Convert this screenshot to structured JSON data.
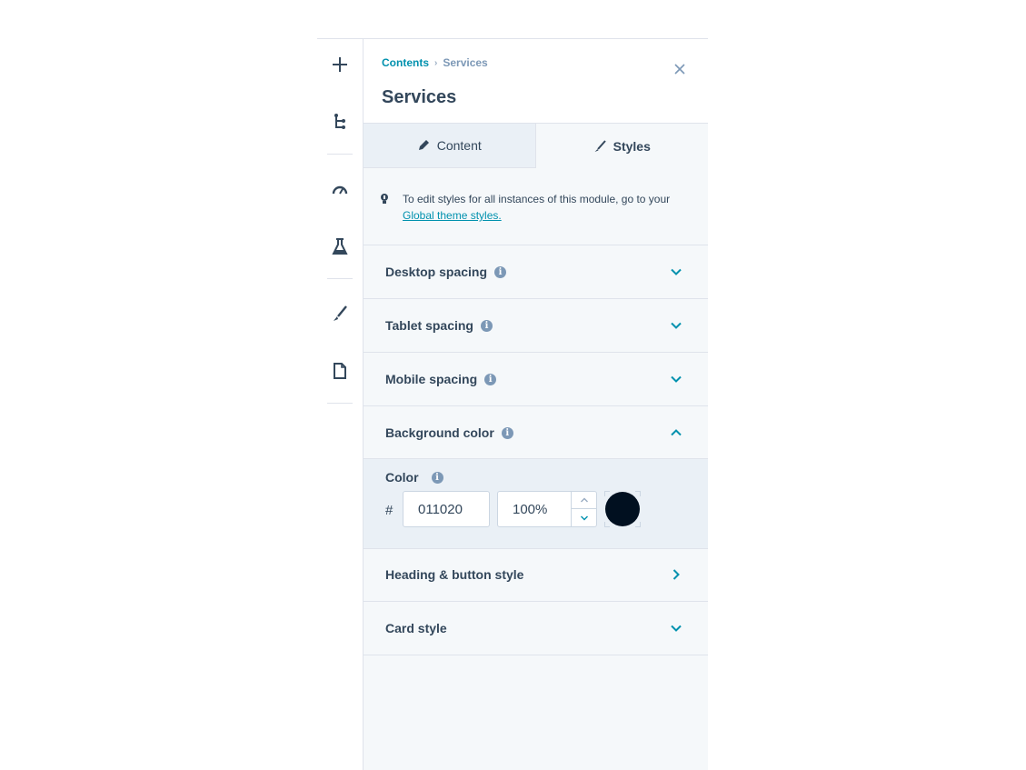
{
  "breadcrumb": {
    "parent": "Contents",
    "separator": "›",
    "current": "Services"
  },
  "panel": {
    "title": "Services"
  },
  "tabs": [
    {
      "label": "Content",
      "icon": "pencil-icon",
      "active": false
    },
    {
      "label": "Styles",
      "icon": "brush-icon",
      "active": true
    }
  ],
  "notice": {
    "text": "To edit styles for all instances of this module, go to your ",
    "link": "Global theme styles."
  },
  "sections": {
    "desktop": "Desktop spacing",
    "tablet": "Tablet spacing",
    "mobile": "Mobile spacing",
    "background": "Background color",
    "heading": "Heading & button style",
    "card": "Card style"
  },
  "color": {
    "label": "Color",
    "hash": "#",
    "hex": "011020",
    "opacity": "100%",
    "swatch": "#011020"
  },
  "theme": {
    "accent": "#0091ae",
    "text": "#33475b",
    "border": "#dfe3eb",
    "panel_bg": "#f5f8fa"
  },
  "rail_icons": [
    "plus-icon",
    "tree-icon",
    "gauge-icon",
    "flask-icon",
    "brush-icon",
    "file-icon"
  ]
}
